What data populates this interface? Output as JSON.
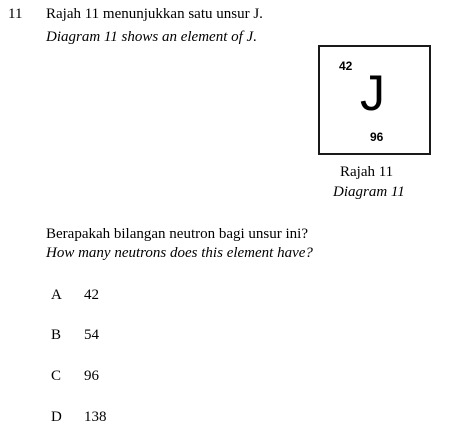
{
  "question": {
    "number": "11",
    "stem_ms": "Rajah 11 menunjukkan satu unsur J.",
    "stem_en": "Diagram 11 shows an element of J."
  },
  "element": {
    "proton_number": "42",
    "symbol": "J",
    "nucleon_number": "96"
  },
  "caption": {
    "ms": "Rajah 11",
    "en": "Diagram 11"
  },
  "prompt": {
    "ms": "Berapakah bilangan neutron bagi unsur ini?",
    "en": "How many neutrons does this element have?"
  },
  "options": [
    {
      "letter": "A",
      "value": "42"
    },
    {
      "letter": "B",
      "value": "54"
    },
    {
      "letter": "C",
      "value": "96"
    },
    {
      "letter": "D",
      "value": "138"
    }
  ]
}
